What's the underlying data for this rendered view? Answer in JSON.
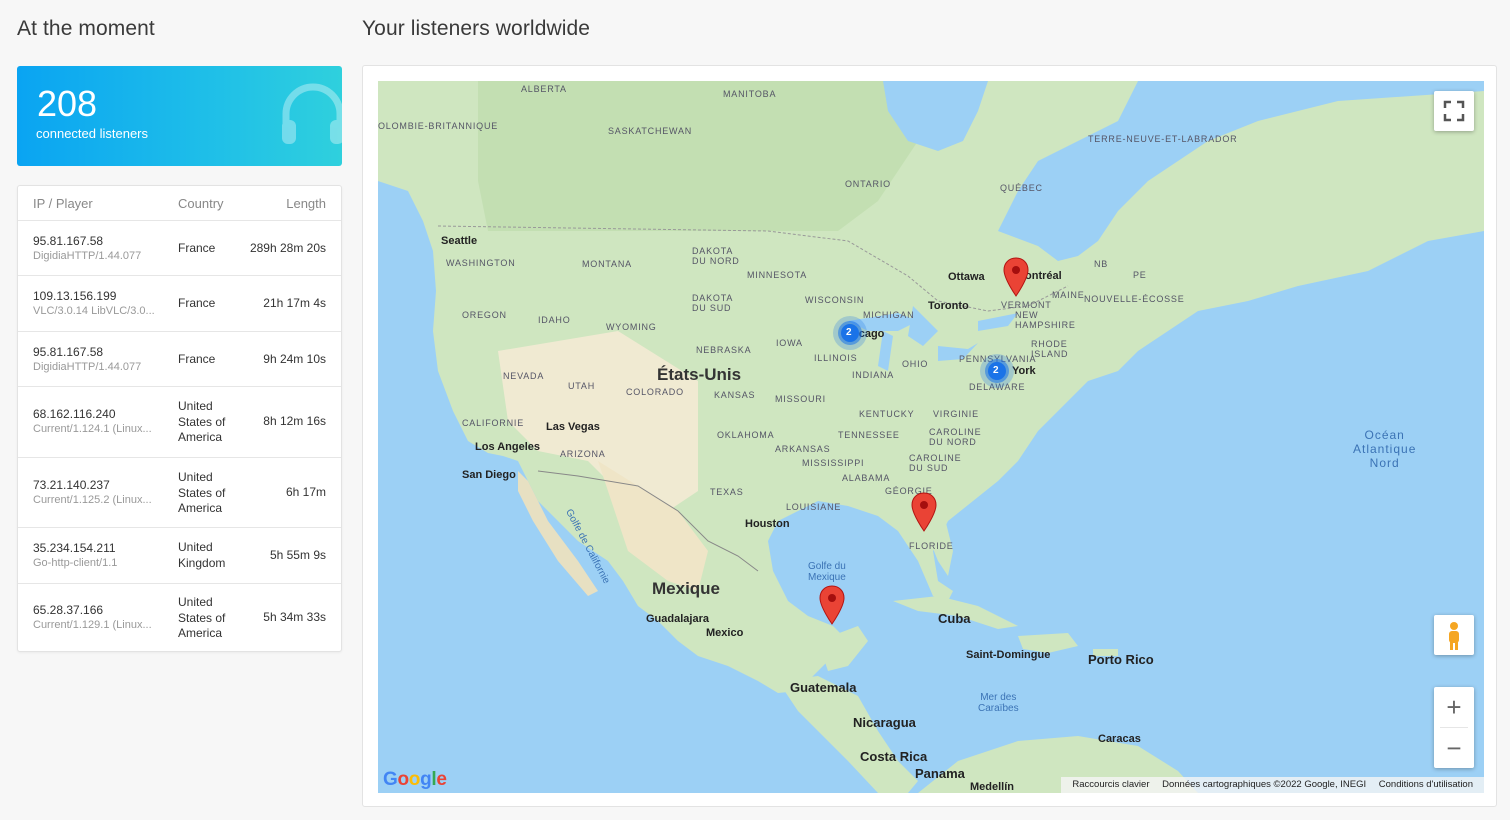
{
  "left_heading": "At the moment",
  "right_heading": "Your listeners worldwide",
  "stats": {
    "count": "208",
    "label": "connected listeners",
    "icon": "headphones-icon"
  },
  "table": {
    "headers": {
      "ip": "IP / Player",
      "country": "Country",
      "length": "Length"
    },
    "rows": [
      {
        "ip": "95.81.167.58",
        "player": "DigidiaHTTP/1.44.077",
        "country": "France",
        "length": "289h 28m 20s"
      },
      {
        "ip": "109.13.156.199",
        "player": "VLC/3.0.14 LibVLC/3.0...",
        "country": "France",
        "length": "21h 17m 4s"
      },
      {
        "ip": "95.81.167.58",
        "player": "DigidiaHTTP/1.44.077",
        "country": "France",
        "length": "9h 24m 10s"
      },
      {
        "ip": "68.162.116.240",
        "player": "Current/1.124.1 (Linux...",
        "country": "United States of America",
        "length": "8h 12m 16s"
      },
      {
        "ip": "73.21.140.237",
        "player": "Current/1.125.2 (Linux...",
        "country": "United States of America",
        "length": "6h 17m"
      },
      {
        "ip": "35.234.154.211",
        "player": "Go-http-client/1.1",
        "country": "United Kingdom",
        "length": "5h 55m 9s"
      },
      {
        "ip": "65.28.37.166",
        "player": "Current/1.129.1 (Linux...",
        "country": "United States of America",
        "length": "5h 34m 33s"
      }
    ]
  },
  "map": {
    "country_labels": {
      "etats_unis": "États-Unis",
      "mexique": "Mexique",
      "cuba": "Cuba",
      "guatemala": "Guatemala",
      "nicaragua": "Nicaragua",
      "costa_rica": "Costa Rica",
      "panama": "Panama",
      "porto_rico": "Porto Rico"
    },
    "region_labels": {
      "alberta": "ALBERTA",
      "manitoba": "MANITOBA",
      "colombie": "OLOMBIE-BRITANNIQUE",
      "saskatchewan": "SASKATCHEWAN",
      "terre_neuve": "TERRE-NEUVE-ET-LABRADOR",
      "ontario": "ONTARIO",
      "quebec": "QUÉBEC",
      "washington": "WASHINGTON",
      "montana": "MONTANA",
      "dakota_nord": "DAKOTA\nDU NORD",
      "minnesota": "MINNESOTA",
      "dakota_sud": "DAKOTA\nDU SUD",
      "wisconsin": "WISCONSIN",
      "oregon": "OREGON",
      "idaho": "IDAHO",
      "wyoming": "WYOMING",
      "michigan": "MICHIGAN",
      "nebraska": "NEBRASKA",
      "iowa": "IOWA",
      "illinois": "ILLINOIS",
      "nevada": "NEVADA",
      "utah": "UTAH",
      "colorado": "COLORADO",
      "kansas": "KANSAS",
      "missouri": "MISSOURI",
      "indiana": "INDIANA",
      "ohio": "OHIO",
      "pennsylvania": "PENNSYLVANIA",
      "california": "CALIFORNIE",
      "kentucky": "KENTUCKY",
      "virginie": "VIRGINIE",
      "tennessee": "TENNESSEE",
      "oklahoma": "OKLAHOMA",
      "arizona": "ARIZONA",
      "arkansas": "ARKANSAS",
      "caroline_nord": "CAROLINE\nDU NORD",
      "mississippi": "MISSISSIPPI",
      "caroline_sud": "CAROLINE\nDU SUD",
      "alabama": "ALABAMA",
      "texas": "TEXAS",
      "georgie": "GÉORGIE",
      "louisiane": "LOUISIANE",
      "floride": "FLORIDE",
      "vermont": "VERMONT",
      "maine": "MAINE",
      "new_hampshire": "NEW\nHAMPSHIRE",
      "rhode_island": "RHODE\nISLAND",
      "nouvelle_ecosse": "NOUVELLE-ÉCOSSE",
      "nb": "NB",
      "pe": "PE",
      "delaware": "DELAWARE"
    },
    "cities": {
      "seattle": "Seattle",
      "ottawa": "Ottawa",
      "montreal": "ontréal",
      "toronto": "Toronto",
      "chicago": "Chicago",
      "new_york": "York",
      "las_vegas": "Las Vegas",
      "los_angeles": "Los Angeles",
      "san_diego": "San Diego",
      "houston": "Houston",
      "guadalajara": "Guadalajara",
      "mexico": "Mexico",
      "saint_domingue": "Saint-Domingue",
      "caracas": "Caracas",
      "medellin": "Medellín"
    },
    "seas": {
      "ocean": "Océan\nAtlantique\nNord",
      "golfe_mexique": "Golfe du\nMexique",
      "caraibes": "Mer des\nCaraïbes",
      "golfe_californie": "Golfe de Californie"
    },
    "clusters": [
      {
        "count": "2"
      },
      {
        "count": "2"
      }
    ],
    "zoom_in": "+",
    "zoom_out": "−",
    "google_logo": "Google",
    "attribution": {
      "shortcuts": "Raccourcis clavier",
      "data": "Données cartographiques ©2022 Google, INEGI",
      "terms": "Conditions d'utilisation"
    },
    "colors": {
      "water": "#9cd0f5",
      "land": "#cfe6c0",
      "desert": "#f3ead0",
      "pin": "#ea4335",
      "cluster": "#1a73e8"
    }
  }
}
